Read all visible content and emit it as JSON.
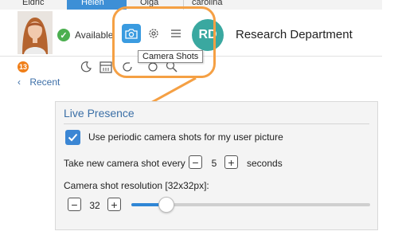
{
  "tabs": [
    "Eldric",
    "Helen",
    "Olga",
    "carolina"
  ],
  "header": {
    "status": "Available",
    "avatar_initials": "RD",
    "department": "Research Department",
    "tooltip": "Camera Shots"
  },
  "toolbar": {
    "badge_count": "13"
  },
  "recent": {
    "label": "Recent"
  },
  "live_presence": {
    "title": "Live Presence",
    "periodic_label": "Use periodic camera shots for my user picture",
    "periodic_checked": true,
    "interval_label": "Take new camera shot every",
    "interval_value": "5",
    "interval_unit": "seconds",
    "resolution_label": "Camera shot resolution [32x32px]:",
    "resolution_value": "32",
    "slider_fraction": 0.12,
    "minus": "−",
    "plus": "+"
  },
  "colors": {
    "accent": "#3b86d4",
    "highlight": "#f5a044",
    "avatar": "#3aa8a0",
    "badge": "#f07f19"
  }
}
